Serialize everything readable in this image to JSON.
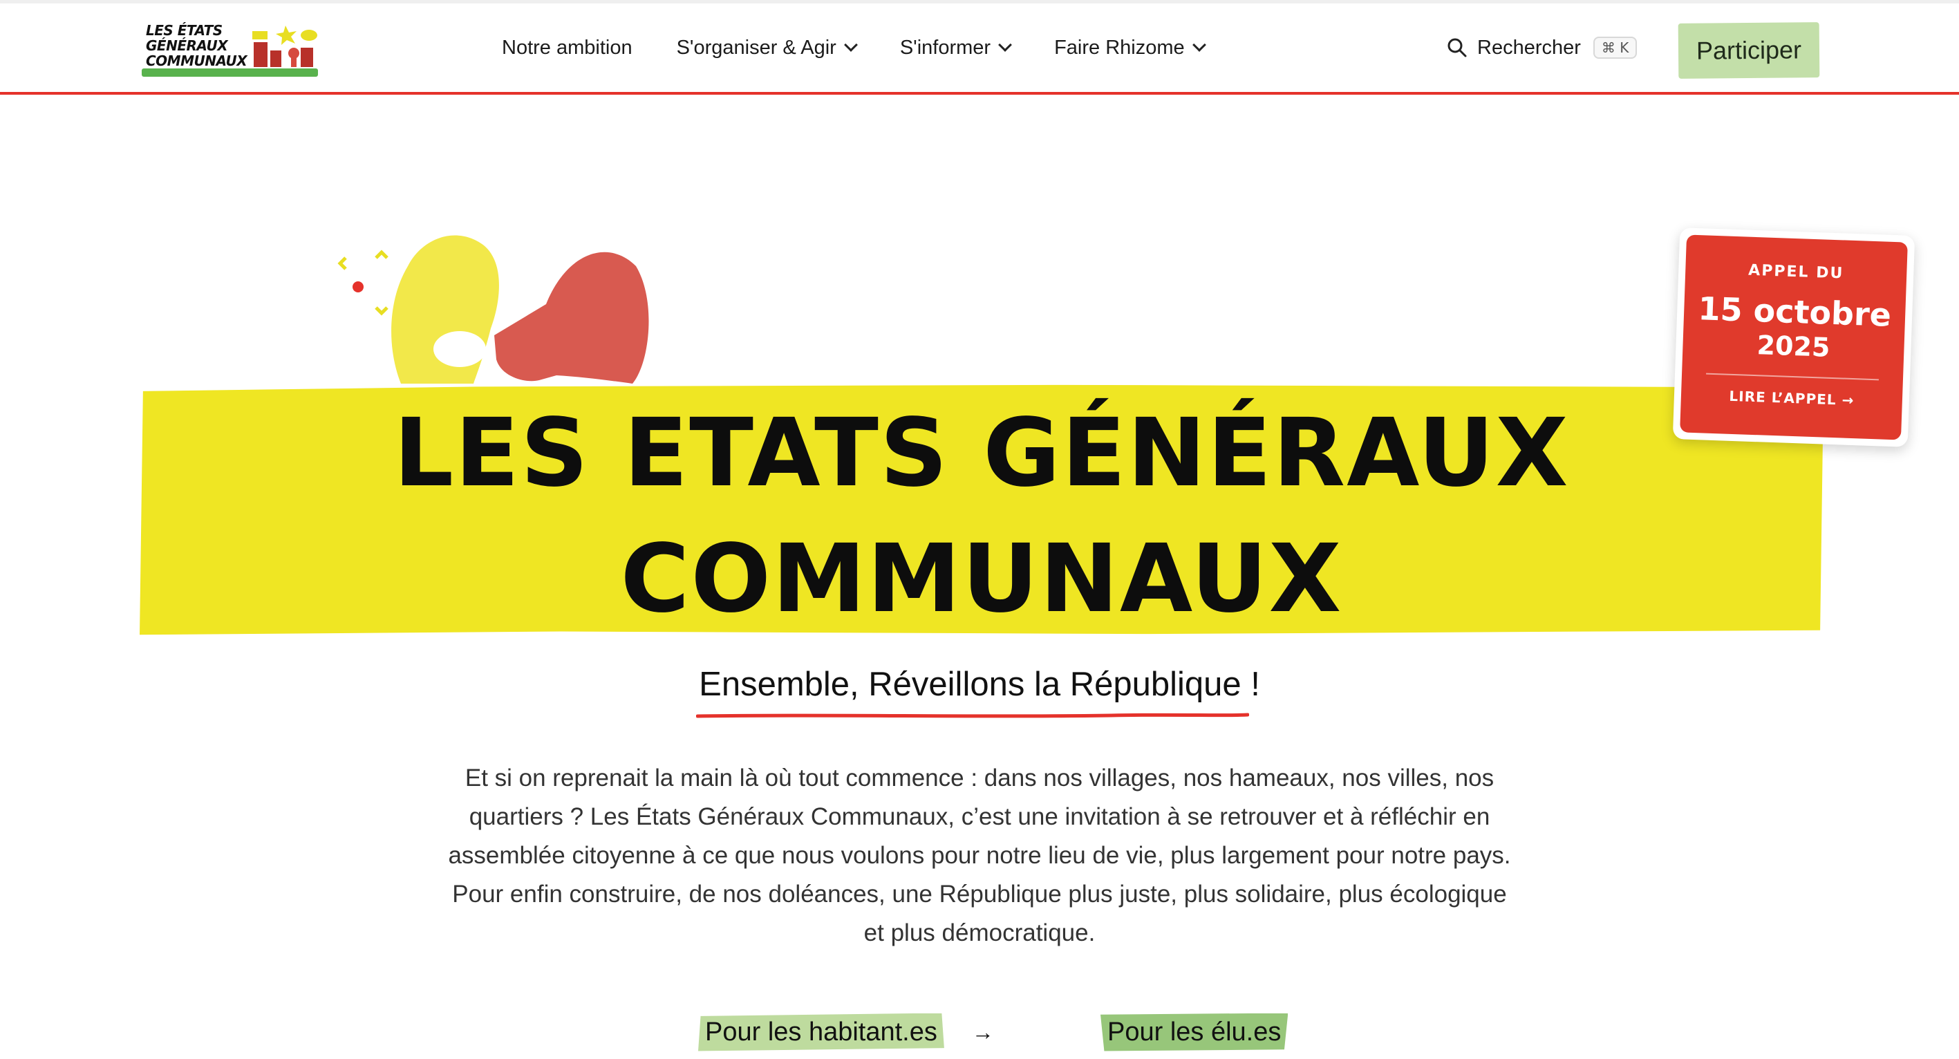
{
  "header": {
    "logo_lines": [
      "LES ÉTATS",
      "GÉNÉRAUX",
      "COMMUNAUX"
    ],
    "nav": [
      {
        "label": "Notre ambition",
        "dropdown": false
      },
      {
        "label": "S'organiser & Agir",
        "dropdown": true
      },
      {
        "label": "S'informer",
        "dropdown": true
      },
      {
        "label": "Faire Rhizome",
        "dropdown": true
      }
    ],
    "search_label": "Rechercher",
    "search_shortcut": "⌘ K",
    "cta_label": "Participer"
  },
  "hero": {
    "title_line1": "LES ETATS GÉNÉRAUX",
    "title_line2": "COMMUNAUX",
    "subtitle": "Ensemble, Réveillons la République !",
    "intro": "Et si on reprenait la main là où tout commence : dans nos villages, nos hameaux, nos villes, nos quartiers ? Les États Généraux Communaux, c’est une invitation à se retrouver et à réfléchir en assemblée citoyenne à ce que nous voulons pour notre lieu de vie, plus largement pour notre pays. Pour enfin construire, de nos doléances, une République plus juste, plus solidaire, plus écologique et plus démocratique."
  },
  "appel_card": {
    "kicker": "APPEL DU",
    "date": "15 octobre",
    "year": "2025",
    "link_label": "LIRE L’APPEL →"
  },
  "ctas": {
    "habitants_label": "Pour les habitant.es",
    "habitants_arrow": "→",
    "elus_label": "Pour les élu.es"
  },
  "colors": {
    "accent_red": "#e5322b",
    "hero_yellow": "#efe623",
    "cta_green_light": "#c3dfa9",
    "cta_green": "#97c67a",
    "megaphone_red": "#d85a50"
  }
}
